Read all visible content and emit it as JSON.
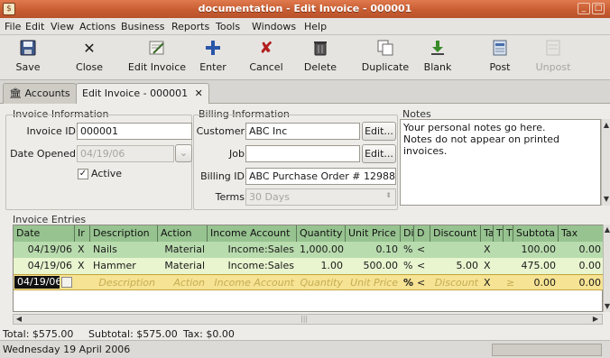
{
  "window": {
    "title": "documentation - Edit Invoice - 000001"
  },
  "menu": [
    "File",
    "Edit",
    "View",
    "Actions",
    "Business",
    "Reports",
    "Tools",
    "Windows",
    "Help"
  ],
  "toolbar": {
    "save": "Save",
    "close": "Close",
    "edit_invoice": "Edit Invoice",
    "enter": "Enter",
    "cancel": "Cancel",
    "delete": "Delete",
    "duplicate": "Duplicate",
    "blank": "Blank",
    "post": "Post",
    "unpost": "Unpost"
  },
  "tabs": {
    "accounts": "Accounts",
    "edit_invoice": "Edit Invoice - 000001"
  },
  "invoice_info": {
    "section": "Invoice Information",
    "invoice_id_label": "Invoice ID",
    "invoice_id": "000001",
    "date_opened_label": "Date Opened",
    "date_opened": "04/19/06",
    "active_label": "Active",
    "active": true
  },
  "billing_info": {
    "section": "Billing Information",
    "customer_label": "Customer",
    "customer": "ABC Inc",
    "customer_edit": "Edit...",
    "job_label": "Job",
    "job": "",
    "job_edit": "Edit...",
    "billing_id_label": "Billing ID",
    "billing_id": "ABC Purchase Order # 12988",
    "terms_label": "Terms",
    "terms": "30 Days"
  },
  "notes": {
    "section": "Notes",
    "line1": "Your personal notes go here.",
    "line2": "Notes do not appear on printed invoices."
  },
  "entries": {
    "section": "Invoice Entries",
    "headers": {
      "date": "Date",
      "ir": "Ir",
      "description": "Description",
      "action": "Action",
      "income_account": "Income Account",
      "quantity": "Quantity",
      "unit_price": "Unit Price",
      "di": "Di",
      "d": "D",
      "discount": "Discount",
      "ta": "Ta",
      "t": "T",
      "t2": "T",
      "subtotal": "Subtota",
      "tax": "Tax"
    },
    "rows": [
      {
        "date": "04/19/06",
        "ir": "X",
        "description": "Nails",
        "action": "Material",
        "income_account": "Income:Sales",
        "quantity": "1,000.00",
        "unit_price": "0.10",
        "di": "%",
        "d": "<",
        "discount": "",
        "ta": "X",
        "t": "",
        "subtotal": "100.00",
        "tax": "0.00"
      },
      {
        "date": "04/19/06",
        "ir": "X",
        "description": "Hammer",
        "action": "Material",
        "income_account": "Income:Sales",
        "quantity": "1.00",
        "unit_price": "500.00",
        "di": "%",
        "d": "<",
        "discount": "5.00",
        "ta": "X",
        "t": "",
        "subtotal": "475.00",
        "tax": "0.00"
      }
    ],
    "blank_row": {
      "date": "04/19/06",
      "description": "Description",
      "action": "Action",
      "income_account": "Income Account",
      "quantity": "Quantity",
      "unit_price": "Unit Price",
      "di": "%",
      "d": "<",
      "discount": "Discount",
      "ta": "X",
      "t": "≥",
      "subtotal": "0.00",
      "tax": "0.00"
    }
  },
  "totals": {
    "total": "Total: $575.00",
    "subtotal": "Subtotal: $575.00",
    "tax": "Tax: $0.00"
  },
  "status": {
    "date": "Wednesday 19 April 2006"
  }
}
